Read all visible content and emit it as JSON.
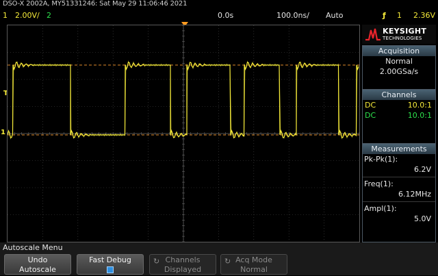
{
  "title_line": "DSO-X 2002A, MY51331246: Sat May 29 11:06:46 2021",
  "status": {
    "ch1_number": "1",
    "ch1_scale": "2.00V/",
    "ch2_number": "2",
    "timebase_position": "0.0s",
    "timebase_scale": "100.0ns/",
    "trigger_mode": "Auto",
    "trigger_icon": "ƒ",
    "trigger_channel": "1",
    "trigger_level": "2.36V"
  },
  "markers": {
    "trigger_level_marker": "T",
    "ch1_ground_marker": "1"
  },
  "brand": {
    "name": "KEYSIGHT",
    "subtitle": "TECHNOLOGIES"
  },
  "acquisition": {
    "heading": "Acquisition",
    "mode": "Normal",
    "sample_rate": "2.00GSa/s"
  },
  "channels": {
    "heading": "Channels",
    "rows": [
      {
        "coupling": "DC",
        "probe": "10.0:1",
        "color": "#f7ec3a"
      },
      {
        "coupling": "DC",
        "probe": "10.0:1",
        "color": "#2ee34d"
      }
    ]
  },
  "measurements": {
    "heading": "Measurements",
    "items": [
      {
        "label": "Pk-Pk(1):",
        "value": "6.2V"
      },
      {
        "label": "Freq(1):",
        "value": "6.12MHz"
      },
      {
        "label": "Ampl(1):",
        "value": "5.0V"
      }
    ]
  },
  "softkeys": {
    "menu_title": "Autoscale Menu",
    "undo": {
      "line1": "Undo",
      "line2": "Autoscale"
    },
    "fast_debug": {
      "line1": "Fast Debug"
    },
    "channels": {
      "line1": "Channels",
      "line2": "Displayed"
    },
    "acq_mode": {
      "line1": "Acq Mode",
      "line2": "Normal"
    }
  },
  "colors": {
    "ch1": "#f7ec3a",
    "ch2": "#2ee34d",
    "trigger": "#ff9b1f",
    "grid": "#4a4a4a"
  }
}
